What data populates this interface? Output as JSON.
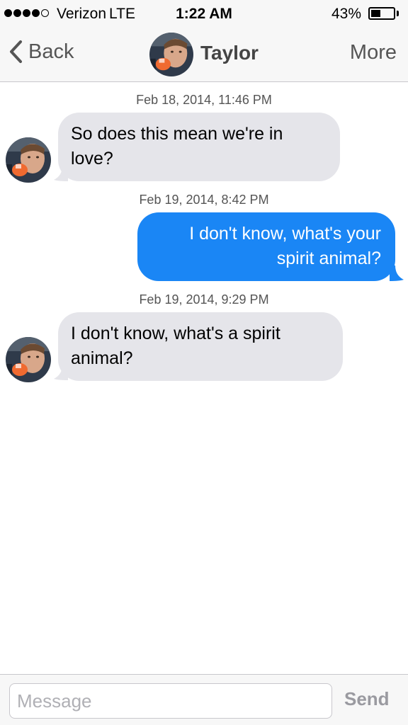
{
  "status_bar": {
    "carrier": "Verizon",
    "network": "LTE",
    "time": "1:22 AM",
    "battery_percent": "43%",
    "battery_level": 0.43,
    "signal_bars_filled": 4,
    "signal_bars_total": 5
  },
  "nav": {
    "back_label": "Back",
    "contact_name": "Taylor",
    "more_label": "More"
  },
  "messages": [
    {
      "timestamp": "Feb 18, 2014, 11:46 PM",
      "direction": "incoming",
      "lines": [
        "So does this mean we're in",
        "love?"
      ]
    },
    {
      "timestamp": "Feb 19, 2014, 8:42 PM",
      "direction": "outgoing",
      "lines": [
        "I don't know, what's your",
        "spirit animal?"
      ]
    },
    {
      "timestamp": "Feb 19, 2014, 9:29 PM",
      "direction": "incoming",
      "lines": [
        "I don't know, what's a spirit",
        "animal?"
      ]
    }
  ],
  "composer": {
    "placeholder": "Message",
    "send_label": "Send"
  },
  "colors": {
    "outgoing_bubble": "#1a86f5",
    "incoming_bubble": "#e5e5ea",
    "bar_background": "#f7f7f7"
  },
  "icons": {
    "back": "chevron-left-icon",
    "avatar": "contact-avatar"
  }
}
